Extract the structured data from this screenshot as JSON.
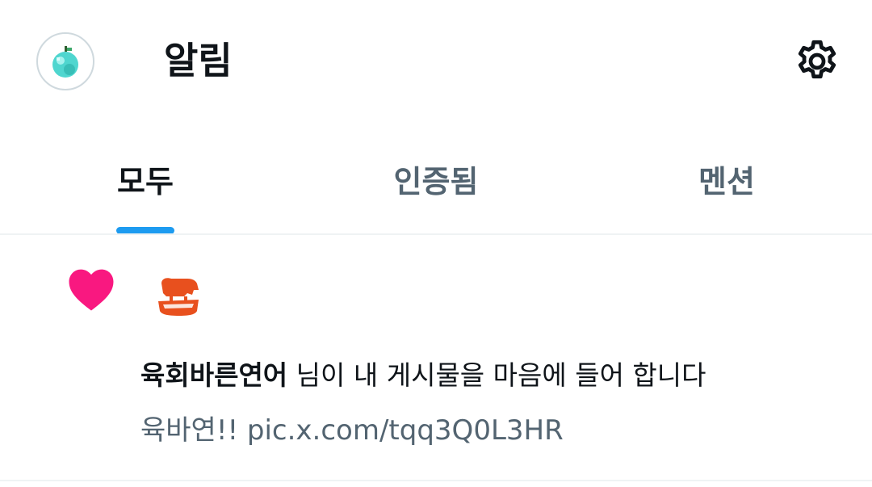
{
  "header": {
    "title": "알림",
    "avatar_icon": "diamond-apple-icon",
    "settings_icon": "gear-icon"
  },
  "tabs": [
    {
      "label": "모두",
      "active": true
    },
    {
      "label": "인증됨",
      "active": false
    },
    {
      "label": "멘션",
      "active": false
    }
  ],
  "notifications": [
    {
      "type_icon": "heart-icon",
      "actor_avatar_icon": "cow-logo-icon",
      "actor_name": "육회바른연어",
      "action_text": " 님이 내 게시물을 마음에 들어 합니다",
      "preview": "육바연!! pic.x.com/tqq3Q0L3HR"
    }
  ],
  "colors": {
    "accent": "#1d9bf0",
    "like": "#f91880",
    "secondary_text": "#536471",
    "primary_text": "#0f1419",
    "divider": "#eff3f4",
    "brand_orange": "#e8501e"
  }
}
